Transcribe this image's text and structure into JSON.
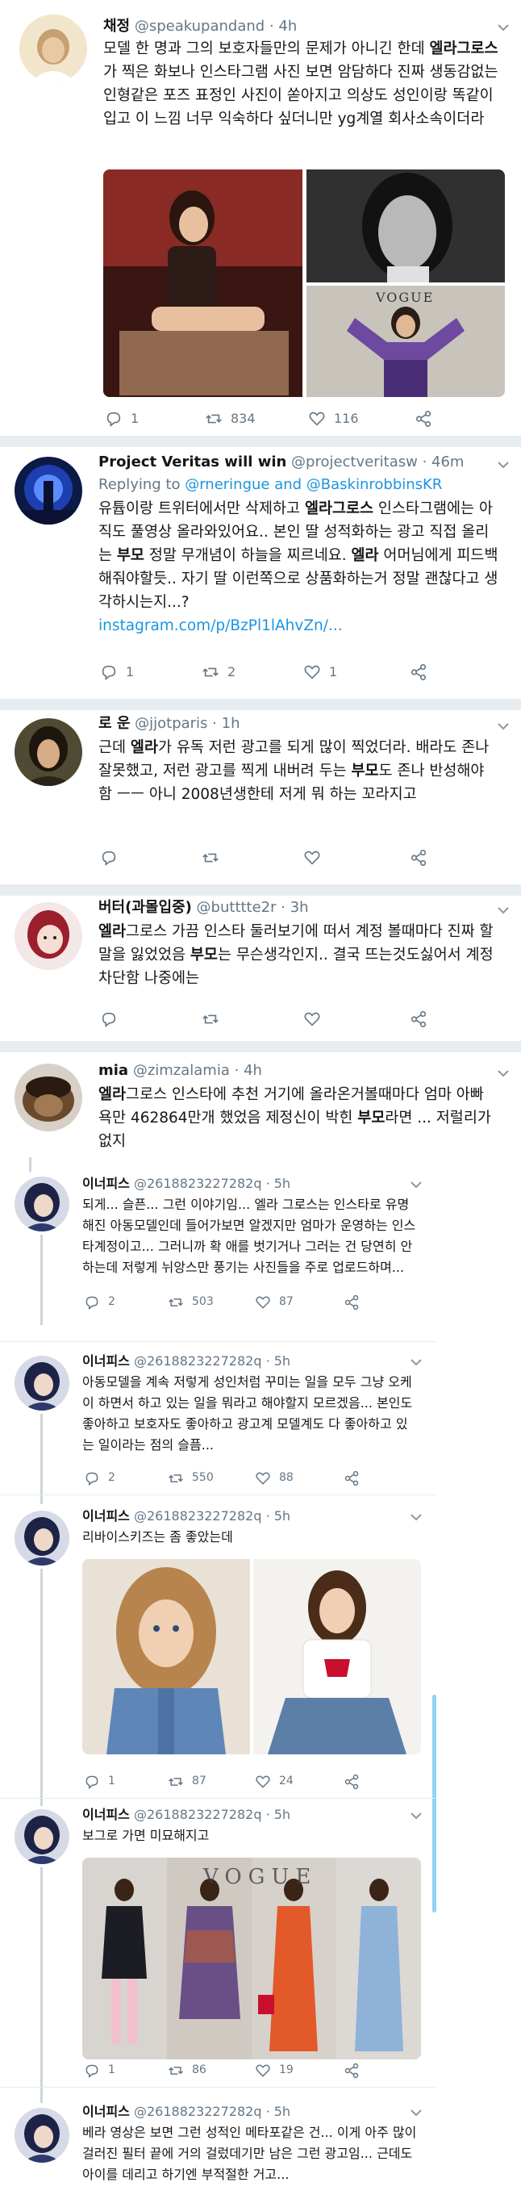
{
  "tweets": [
    {
      "name": "채정",
      "handle": "@speakupandand",
      "time": "4h",
      "text": "모델 한 명과 그의 보호자들만의 문제가 아니긴 한데 엘라그로스가 찍은 화보나 인스타그램 사진 보면 암담하다 진짜 생동감없는 인형같은 포즈 표정인 사진이 쏟아지고 의상도 성인이랑 똑같이 입고 이 느낌 너무 익숙하다 싶더니만 yg계열 회사소속이더라",
      "bold": "엘라그로스",
      "image_labels": {
        "vogue": "VOGUE"
      },
      "replies": "1",
      "retweets": "834",
      "likes": "116"
    },
    {
      "name": "Project Veritas will win",
      "handle": "@projectveritasw",
      "time": "46m",
      "replying_label": "Replying to ",
      "replying_users": "@rneringue and @BaskinrobbinsKR",
      "text_pre": "유튭이랑 트위터에서만 삭제하고 ",
      "bold1": "엘라그로스",
      "text_mid1": " 인스타그램에는 아직도 풀영상 올라와있어요.. 본인 딸 성적화하는 광고 직접 올리는 ",
      "bold2": "부모",
      "text_mid2": " 정말 무개념이 하늘을 찌르네요. ",
      "bold3": "엘라",
      "text_post": " 어머님에게 피드백해줘야할듯.. 자기 딸 이런쪽으로 상품화하는거 정말 괜찮다고 생각하시는지...?",
      "link": "instagram.com/p/BzPl1lAhvZn/...",
      "replies": "1",
      "retweets": "2",
      "likes": "1"
    },
    {
      "name": "로 운",
      "handle": "@jjotparis",
      "time": "1h",
      "text_pre": "근데 ",
      "bold1": "엘라",
      "text_mid": "가 유독 저런 광고를 되게 많이 찍었더라. 배라도 존나 잘못했고, 저런 광고를 찍게 내버려 두는 ",
      "bold2": "부모",
      "text_post": "도 존나 반성해야 함 ㅡㅡ 아니 2008년생한테 저게 뭐 하는 꼬라지고"
    },
    {
      "name": "버터(과몰입중)",
      "handle": "@butttte2r",
      "time": "3h",
      "bold1": "엘라",
      "text_pre": "그로스 가끔 인스타 둘러보기에 떠서 계정 볼때마다 진짜 할말을 잃었었음 ",
      "bold2": "부모",
      "text_post": "는 무슨생각인지.. 결국 뜨는것도싫어서 계정 차단함 나중에는"
    },
    {
      "name": "mia",
      "handle": "@zimzalamia",
      "time": "4h",
      "bold1": "엘라",
      "text_pre": "그로스 인스타에 추천 거기에 올라온거볼때마다 엄마 아빠 욕만 462864만개 했었음 제정신이 박힌 ",
      "bold2": "부모",
      "text_post": "라면 ... 저럴리가없지"
    }
  ],
  "thread": [
    {
      "name": "이너피스",
      "handle": "@2618823227282q",
      "time": "5h",
      "text": "되게... 슬픈... 그런 이야기임... 엘라 그로스는 인스타로 유명해진 아동모델인데 들어가보면 알겠지만 엄마가 운영하는 인스타계정이고... 그러니까 확 애를 벗기거나 그러는 건 당연히 안하는데 저렇게 뉘앙스만 풍기는 사진들을 주로 업로드하며...",
      "replies": "2",
      "retweets": "503",
      "likes": "87"
    },
    {
      "name": "이너피스",
      "handle": "@2618823227282q",
      "time": "5h",
      "text": "아동모델을 계속 저렇게 성인처럼 꾸미는 일을 모두 그냥 오케이 하면서 하고 있는 일을 뭐라고 해야할지 모르겠음... 본인도 좋아하고 보호자도 좋아하고 광고계 모델계도 다 좋아하고 있는 일이라는 점의 슬픔...",
      "replies": "2",
      "retweets": "550",
      "likes": "88"
    },
    {
      "name": "이너피스",
      "handle": "@2618823227282q",
      "time": "5h",
      "text": "리바이스키즈는 좀 좋았는데",
      "replies": "1",
      "retweets": "87",
      "likes": "24"
    },
    {
      "name": "이너피스",
      "handle": "@2618823227282q",
      "time": "5h",
      "text": "보그로 가면 미묘해지고",
      "image_labels": {
        "vogue": "VOGUE"
      },
      "replies": "1",
      "retweets": "86",
      "likes": "19"
    },
    {
      "name": "이너피스",
      "handle": "@2618823227282q",
      "time": "5h",
      "text": "베라 영상은 보면 그런 성적인 메타포같은 건... 이게 아주 많이 걸러진 필터 끝에 거의 걸렀데기만 남은 그런 광고임... 근데도 아이를 데리고 하기엔 부적절한 거고..."
    }
  ],
  "colors": {
    "text": "#14171a",
    "secondary": "#657786",
    "link": "#1b95e0",
    "divider": "#e6ecf0"
  }
}
